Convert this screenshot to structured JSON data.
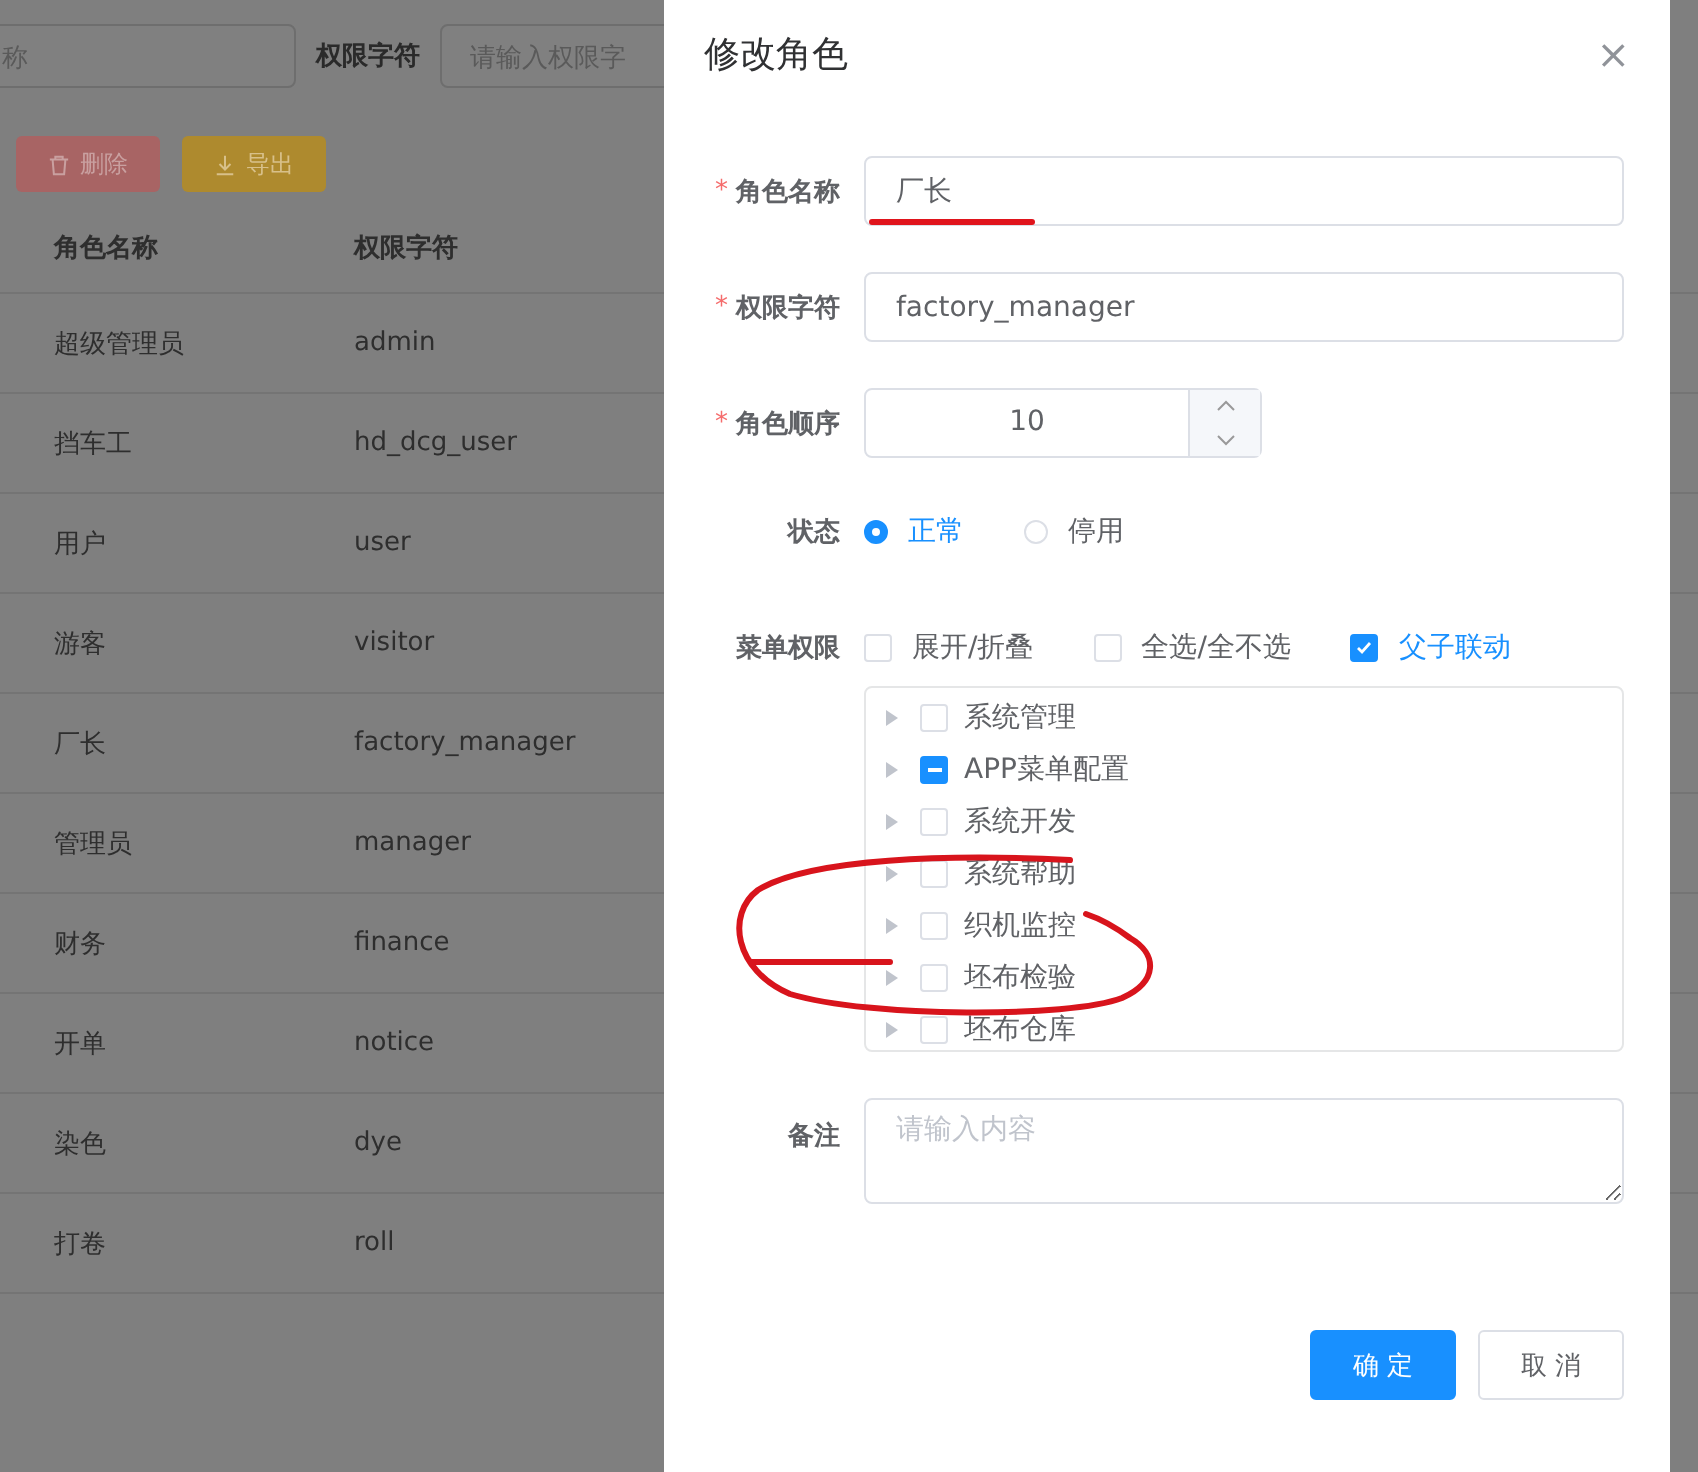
{
  "background_page": {
    "filters": [
      {
        "placeholder": "称"
      },
      {
        "label": "权限字符",
        "placeholder": "请输入权限字"
      }
    ],
    "buttons": [
      {
        "kind": "delete",
        "label": "删除"
      },
      {
        "kind": "export",
        "label": "导出"
      }
    ],
    "table": {
      "columns": [
        "角色名称",
        "权限字符"
      ],
      "rows": [
        [
          "超级管理员",
          "admin"
        ],
        [
          "挡车工",
          "hd_dcg_user"
        ],
        [
          "用户",
          "user"
        ],
        [
          "游客",
          "visitor"
        ],
        [
          "厂长",
          "factory_manager"
        ],
        [
          "管理员",
          "manager"
        ],
        [
          "财务",
          "finance"
        ],
        [
          "开单",
          "notice"
        ],
        [
          "染色",
          "dye"
        ],
        [
          "打卷",
          "roll"
        ]
      ]
    }
  },
  "dialog": {
    "title": "修改角色",
    "close": "×",
    "fields": [
      {
        "kind": "text",
        "label": "角色名称",
        "required_mark": "*",
        "value": "厂长"
      },
      {
        "kind": "text",
        "label": "权限字符",
        "required_mark": "*",
        "value": "factory_manager"
      },
      {
        "kind": "number",
        "label": "角色顺序",
        "required_mark": "*",
        "value": "10"
      }
    ],
    "status": {
      "label": "状态",
      "options": [
        {
          "label": "正常",
          "selected": true
        },
        {
          "label": "停用",
          "selected": false
        }
      ]
    },
    "menu_permissions": {
      "label": "菜单权限",
      "options": [
        {
          "label": "展开/折叠",
          "checked": false
        },
        {
          "label": "全选/全不选",
          "checked": false
        },
        {
          "label": "父子联动",
          "checked": true
        }
      ],
      "tree": [
        {
          "label": "系统管理",
          "checked": false,
          "indeterminate": false
        },
        {
          "label": "APP菜单配置",
          "checked": false,
          "indeterminate": true
        },
        {
          "label": "系统开发",
          "checked": false,
          "indeterminate": false
        },
        {
          "label": "系统帮助",
          "checked": false,
          "indeterminate": false
        },
        {
          "label": "织机监控",
          "checked": false,
          "indeterminate": false
        },
        {
          "label": "坯布检验",
          "checked": false,
          "indeterminate": false
        },
        {
          "label": "坯布仓库",
          "checked": false,
          "indeterminate": false
        }
      ]
    },
    "remark": {
      "label": "备注",
      "placeholder": "请输入内容"
    },
    "buttons": [
      {
        "kind": "primary",
        "label": "确 定"
      },
      {
        "kind": "default",
        "label": "取 消"
      }
    ]
  }
}
